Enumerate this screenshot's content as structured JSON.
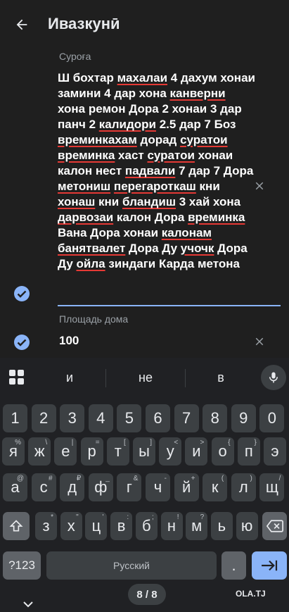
{
  "header": {
    "title": "Ивазкунӣ"
  },
  "form": {
    "address_label": "Суроға",
    "address_segments": [
      {
        "t": "Ш бохтар ",
        "u": false
      },
      {
        "t": "махалаи",
        "u": true
      },
      {
        "t": " 4 дахум хонаи замини 4 дар хона ",
        "u": false
      },
      {
        "t": "канверни",
        "u": true
      },
      {
        "t": " хона ремон Дора 2 хонаи 3 дар панч 2 ",
        "u": false
      },
      {
        "t": "калидори",
        "u": true
      },
      {
        "t": " 2.5 дар 7 Боз ",
        "u": false
      },
      {
        "t": "времинкахам",
        "u": true
      },
      {
        "t": " дорад ",
        "u": false
      },
      {
        "t": "суратои",
        "u": true
      },
      {
        "t": " ",
        "u": false
      },
      {
        "t": "времинка",
        "u": true
      },
      {
        "t": " хаст ",
        "u": false
      },
      {
        "t": "суратои",
        "u": true
      },
      {
        "t": " хонаи калон нест ",
        "u": false
      },
      {
        "t": "падвали",
        "u": true
      },
      {
        "t": " 7 дар 7 Дора ",
        "u": false
      },
      {
        "t": "метониш",
        "u": true
      },
      {
        "t": " ",
        "u": false
      },
      {
        "t": "перегароткаш",
        "u": true
      },
      {
        "t": " кни ",
        "u": false
      },
      {
        "t": "хонаш",
        "u": true
      },
      {
        "t": " кни ",
        "u": false
      },
      {
        "t": "бландиш",
        "u": true
      },
      {
        "t": " 3 хай хона ",
        "u": false
      },
      {
        "t": "дарвозаи",
        "u": true
      },
      {
        "t": " калон Дора ",
        "u": false
      },
      {
        "t": "времинка",
        "u": true
      },
      {
        "t": " Вана Дора хонаи ",
        "u": false
      },
      {
        "t": "калонам",
        "u": true
      },
      {
        "t": " ",
        "u": false
      },
      {
        "t": "банятвалет",
        "u": true
      },
      {
        "t": " Дора Ду ",
        "u": false
      },
      {
        "t": "учочк",
        "u": true
      },
      {
        "t": " Дора Ду ",
        "u": false
      },
      {
        "t": "ойла",
        "u": true
      },
      {
        "t": " зиндаги Карда метона",
        "u": false
      }
    ],
    "area_label": "Площадь дома",
    "area_value": "100"
  },
  "keyboard": {
    "suggestions": [
      "и",
      "не",
      "в"
    ],
    "number_row": [
      "1",
      "2",
      "3",
      "4",
      "5",
      "6",
      "7",
      "8",
      "9",
      "0"
    ],
    "row1": [
      {
        "k": "я",
        "a": "%"
      },
      {
        "k": "ж",
        "a": "\\"
      },
      {
        "k": "е",
        "a": "|"
      },
      {
        "k": "р",
        "a": "="
      },
      {
        "k": "т",
        "a": "["
      },
      {
        "k": "ы",
        "a": "]"
      },
      {
        "k": "у",
        "a": "<"
      },
      {
        "k": "и",
        "a": ">"
      },
      {
        "k": "о",
        "a": "{"
      },
      {
        "k": "п",
        "a": "}"
      },
      {
        "k": "э",
        "a": ""
      }
    ],
    "row2": [
      {
        "k": "а",
        "a": "@"
      },
      {
        "k": "с",
        "a": "#"
      },
      {
        "k": "д",
        "a": "₽"
      },
      {
        "k": "ф",
        "a": "_"
      },
      {
        "k": "г",
        "a": "&"
      },
      {
        "k": "ч",
        "a": "-"
      },
      {
        "k": "й",
        "a": "+"
      },
      {
        "k": "к",
        "a": "("
      },
      {
        "k": "л",
        "a": ")"
      },
      {
        "k": "щ",
        "a": "/"
      }
    ],
    "row3": [
      {
        "k": "з",
        "a": "*"
      },
      {
        "k": "х",
        "a": "\""
      },
      {
        "k": "ц",
        "a": "'"
      },
      {
        "k": "в",
        "a": ":"
      },
      {
        "k": "б",
        "a": ";"
      },
      {
        "k": "н",
        "a": "!"
      },
      {
        "k": "м",
        "a": "?"
      },
      {
        "k": "ь",
        "a": ""
      },
      {
        "k": "ю",
        "a": ""
      }
    ],
    "symbols_label": "?123",
    "space_label": "Русский",
    "period_label": "."
  },
  "footer": {
    "page_indicator": "8 / 8",
    "watermark": "OLA.TJ"
  },
  "colors": {
    "accent": "#8ab4f8",
    "spell_underline": "#e53935",
    "key_bg": "#3c4043"
  }
}
